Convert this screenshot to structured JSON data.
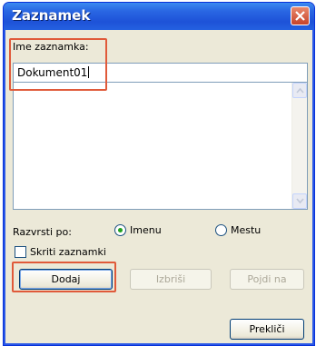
{
  "window": {
    "title": "Zaznamek"
  },
  "form": {
    "name_label": "Ime zaznamka:",
    "name_value": "Dokument01",
    "sort_label": "Razvrsti po:",
    "sort_options": [
      {
        "label": "Imenu",
        "selected": true
      },
      {
        "label": "Mestu",
        "selected": false
      }
    ],
    "hide_checkbox_label": "Skriti zaznamki",
    "hide_checked": false
  },
  "buttons": {
    "add": "Dodaj",
    "delete": "Izbriši",
    "goto": "Pojdi na",
    "cancel": "Prekliči"
  },
  "icons": [
    "close-icon",
    "scroll-up-arrow-icon",
    "scroll-down-arrow-icon"
  ],
  "colors": {
    "titlebar": "#1e52d8",
    "highlight": "#e05a3a",
    "radio_dot": "#21a121"
  }
}
